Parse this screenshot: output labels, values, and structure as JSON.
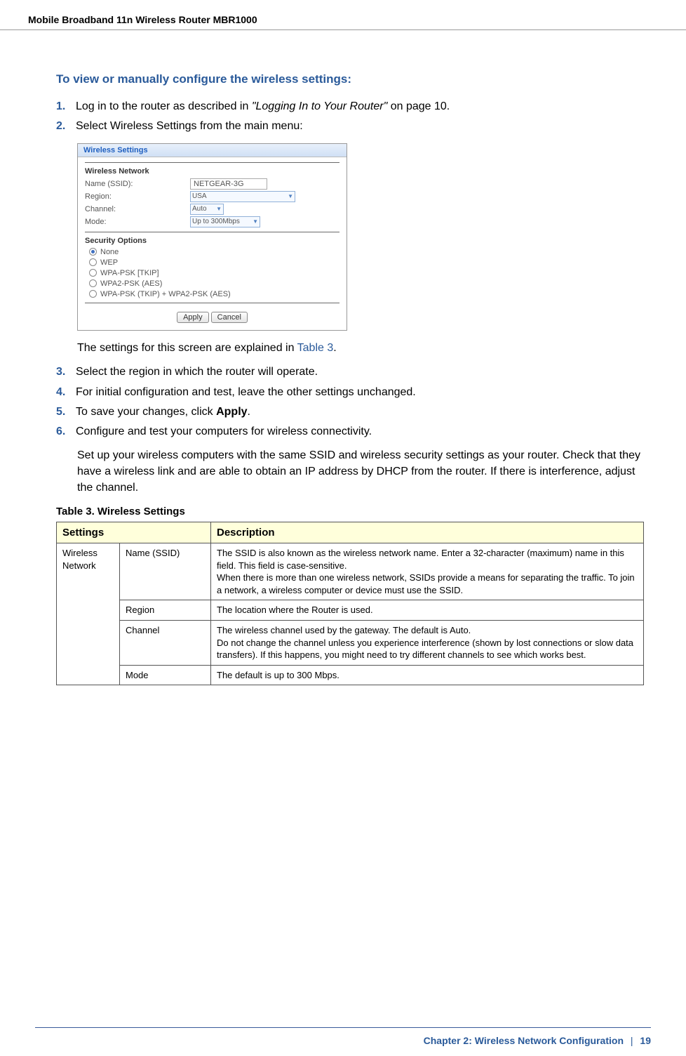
{
  "doc_title": "Mobile Broadband 11n Wireless Router MBR1000",
  "section_heading": "To view or manually configure the wireless settings:",
  "steps_a": [
    {
      "num": "1.",
      "prefix": "Log in to the router as described in ",
      "italic": "\"Logging In to Your Router\"",
      "suffix": " on page 10."
    },
    {
      "num": "2.",
      "prefix": "Select Wireless Settings from the main menu:",
      "italic": "",
      "suffix": ""
    }
  ],
  "screenshot": {
    "tab": "Wireless Settings",
    "network_label": "Wireless Network",
    "rows": {
      "name_label": "Name (SSID):",
      "name_value": "NETGEAR-3G",
      "region_label": "Region:",
      "region_value": "USA",
      "channel_label": "Channel:",
      "channel_value": "Auto",
      "mode_label": "Mode:",
      "mode_value": "Up to 300Mbps"
    },
    "security_label": "Security Options",
    "security_options": [
      "None",
      "WEP",
      "WPA-PSK [TKIP]",
      "WPA2-PSK (AES)",
      "WPA-PSK (TKIP) + WPA2-PSK (AES)"
    ],
    "apply": "Apply",
    "cancel": "Cancel"
  },
  "explain_prefix": "The settings for this screen are explained in ",
  "explain_link": "Table 3",
  "explain_suffix": ".",
  "steps_b": [
    {
      "num": "3.",
      "text": "Select the region in which the router will operate."
    },
    {
      "num": "4.",
      "text": "For initial configuration and test, leave the other settings unchanged."
    },
    {
      "num": "5.",
      "prefix": "To save your changes, click ",
      "bold": "Apply",
      "suffix": "."
    },
    {
      "num": "6.",
      "text": "Configure and test your computers for wireless connectivity."
    }
  ],
  "para": "Set up your wireless computers with the same SSID and wireless security settings as your router. Check that they have a wireless link and are able to obtain an IP address by DHCP from the router. If there is interference, adjust the channel.",
  "table_caption": "Table 3.  Wireless Settings",
  "table": {
    "headers": [
      "Settings",
      "Description"
    ],
    "group_label": "Wireless Network",
    "rows": [
      {
        "setting": "Name (SSID)",
        "desc": "The SSID is also known as the wireless network name. Enter a 32-character (maximum) name in this field. This field is case-sensitive.\nWhen there is more than one wireless network, SSIDs provide a means for separating the traffic. To join a network, a wireless computer or device must use the SSID."
      },
      {
        "setting": "Region",
        "desc": "The location where the Router is used."
      },
      {
        "setting": "Channel",
        "desc": "The wireless channel used by the gateway. The default is Auto.\nDo not change the channel unless you experience interference (shown by lost connections or slow data transfers). If this happens, you might need to try different channels to see which works best."
      },
      {
        "setting": "Mode",
        "desc": "The default is up to 300 Mbps."
      }
    ]
  },
  "footer": {
    "chapter": "Chapter 2:  Wireless Network Configuration",
    "sep": "|",
    "page": "19"
  }
}
